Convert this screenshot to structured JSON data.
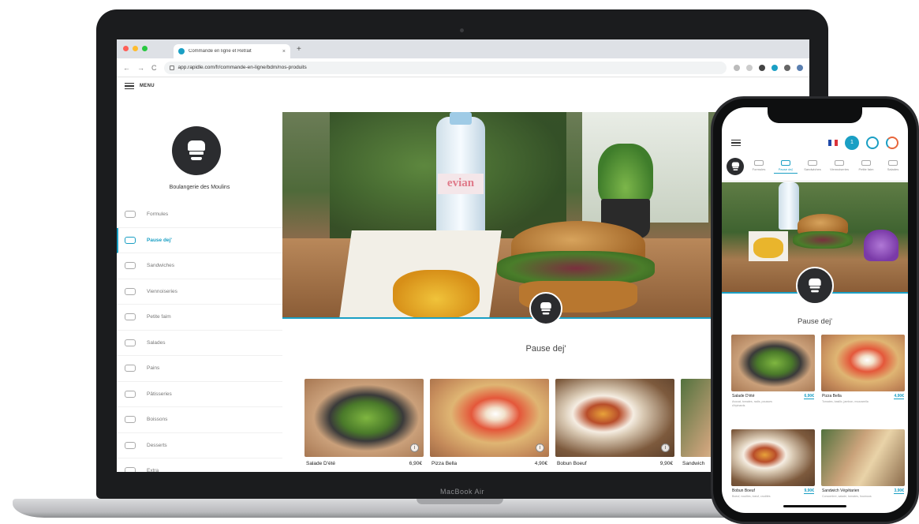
{
  "colors": {
    "accent": "#1a9fc4",
    "dark": "#2b2c2f"
  },
  "browser": {
    "tab_title": "Commande en ligne et Retrait",
    "tab_close": "×",
    "new_tab": "+",
    "url": "app.rapidle.com/fr/commande-en-ligne/bdm/nos-produits",
    "nav": {
      "back": "←",
      "forward": "→",
      "reload": "C"
    }
  },
  "app": {
    "menu_label": "MENU",
    "shop_name": "Boulangerie des Moulins",
    "categories": [
      {
        "label": "Formules",
        "icon": "formula-icon",
        "active": false
      },
      {
        "label": "Pause dej'",
        "icon": "lunch-icon",
        "active": true
      },
      {
        "label": "Sandwiches",
        "icon": "sandwich-icon",
        "active": false
      },
      {
        "label": "Viennoiseries",
        "icon": "croissant-icon",
        "active": false
      },
      {
        "label": "Petite faim",
        "icon": "snack-icon",
        "active": false
      },
      {
        "label": "Salades",
        "icon": "salad-icon",
        "active": false
      },
      {
        "label": "Pains",
        "icon": "bread-icon",
        "active": false
      },
      {
        "label": "Pâtisseries",
        "icon": "cake-icon",
        "active": false
      },
      {
        "label": "Boissons",
        "icon": "drink-icon",
        "active": false
      },
      {
        "label": "Desserts",
        "icon": "dessert-icon",
        "active": false
      },
      {
        "label": "Extra",
        "icon": "extra-icon",
        "active": false
      }
    ],
    "hero_brand": "evian",
    "category_title": "Pause dej'",
    "products": [
      {
        "name": "Salade D'été",
        "price": "6,90€",
        "image": "salad"
      },
      {
        "name": "Pizza Bella",
        "price": "4,90€",
        "image": "pizza"
      },
      {
        "name": "Bobun Boeuf",
        "price": "9,90€",
        "image": "bobun"
      },
      {
        "name": "Sandwich",
        "price": "",
        "image": "sandwich"
      }
    ]
  },
  "laptop": {
    "brand": "MacBook Air"
  },
  "phone": {
    "cart_count": "1",
    "categories": [
      {
        "label": "Formules",
        "active": false
      },
      {
        "label": "Pause dej'",
        "active": true
      },
      {
        "label": "Sandwiches",
        "active": false
      },
      {
        "label": "Viennoiseries",
        "active": false
      },
      {
        "label": "Petite faim",
        "active": false
      },
      {
        "label": "Salades",
        "active": false
      }
    ],
    "title": "Pause dej'",
    "products": [
      {
        "name": "Salade D'été",
        "price": "6,90€",
        "desc": "Avocat, tomates, radis, pousses d'épinards",
        "image": "salad"
      },
      {
        "name": "Pizza Bella",
        "price": "4,90€",
        "desc": "Tomates, basilic, jambon, mozzarella",
        "image": "pizza"
      },
      {
        "name": "Bobun Boeuf",
        "price": "9,90€",
        "desc": "Boeuf, nouilles, bœuf, crudités",
        "image": "bobun"
      },
      {
        "name": "Sandwich Végétarien",
        "price": "3,90€",
        "desc": "Concombre, salade, tomates, houmous",
        "image": "sandwich"
      }
    ]
  }
}
